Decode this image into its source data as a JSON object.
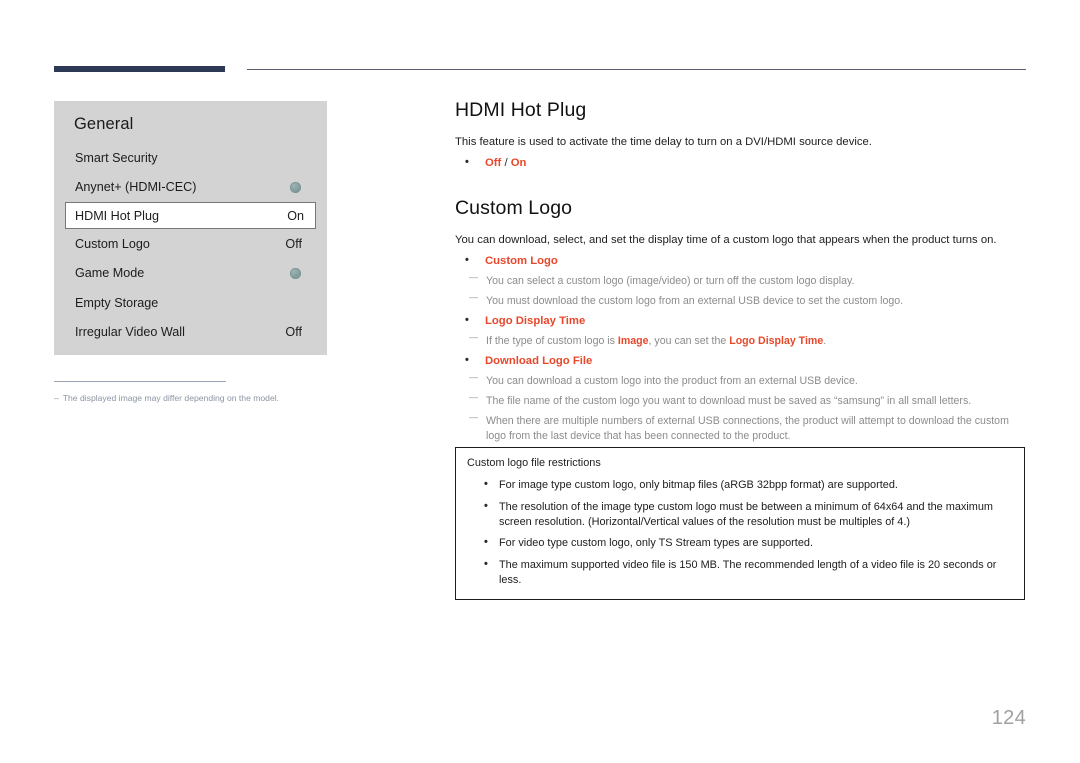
{
  "header": {
    "accent_color": "#2e3a55",
    "rule_color": "#5b5b6b"
  },
  "menu_panel": {
    "title": "General",
    "items": [
      {
        "label": "Smart Security",
        "value": "",
        "control": "none"
      },
      {
        "label": "Anynet+ (HDMI-CEC)",
        "value": "",
        "control": "toggle"
      },
      {
        "label": "HDMI Hot Plug",
        "value": "On",
        "control": "value",
        "selected": true
      },
      {
        "label": "Custom Logo",
        "value": "Off",
        "control": "value"
      },
      {
        "label": "Game Mode",
        "value": "",
        "control": "toggle"
      },
      {
        "label": "Empty Storage",
        "value": "",
        "control": "none"
      },
      {
        "label": "Irregular Video Wall",
        "value": "Off",
        "control": "value"
      }
    ]
  },
  "footnote": {
    "dash": "–",
    "text": "The displayed image may differ depending on the model."
  },
  "sections": [
    {
      "title": "HDMI Hot Plug",
      "lede": "This feature is used to activate the time delay to turn on a DVI/HDMI source device.",
      "option_off": "Off",
      "option_sep": " / ",
      "option_on": "On"
    },
    {
      "title": "Custom Logo",
      "lede": "You can download, select, and set the display time of a custom logo that appears when the product turns on.",
      "bullets": [
        {
          "label": "Custom Logo",
          "notes": [
            {
              "plain": "You can select a custom logo (image/video) or turn off the custom logo display."
            },
            {
              "plain": "You must download the custom logo from an external USB device to set the custom logo."
            }
          ]
        },
        {
          "label": "Logo Display Time",
          "notes": [
            {
              "pre": "If the type of custom logo is ",
              "hl1": "Image",
              "mid": ", you can set the ",
              "hl2": "Logo Display Time",
              "post": "."
            }
          ]
        },
        {
          "label": "Download Logo File",
          "notes": [
            {
              "plain": "You can download a custom logo into the product from an external USB device."
            },
            {
              "plain": "The file name of the custom logo you want to download must be saved as “samsung” in all small letters."
            },
            {
              "plain": "When there are multiple numbers of external USB connections, the product will attempt to download the custom logo from the last device that has been connected to the product."
            }
          ]
        }
      ]
    }
  ],
  "restrictions": {
    "title": "Custom logo file restrictions",
    "items": [
      "For image type custom logo, only bitmap files (aRGB 32bpp format) are supported.",
      "The resolution of the image type custom logo must be between a minimum of 64x64 and the maximum screen resolution. (Horizontal/Vertical values of the resolution must be multiples of 4.)",
      "For video type custom logo, only TS Stream types are supported.",
      "The maximum supported video file is 150 MB. The recommended length of a video file is 20 seconds or less."
    ]
  },
  "page_number": "124",
  "colors": {
    "accent_orange": "#e8472a",
    "panel_bg": "#d3d3d3",
    "note_gray": "#8c8c8c"
  }
}
